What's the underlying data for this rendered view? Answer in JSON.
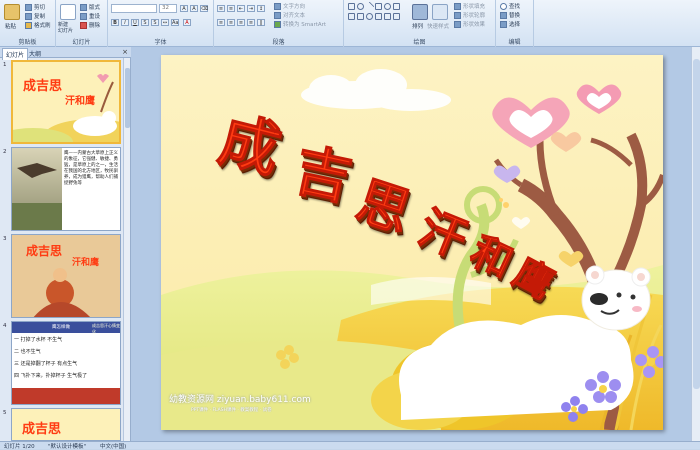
{
  "ribbon": {
    "clipboard": {
      "paste": "粘贴",
      "cut": "剪切",
      "copy": "复制",
      "format_painter": "格式刷",
      "group": "剪贴板"
    },
    "slides": {
      "new_slide": "新建\n幻灯片",
      "layout": "版式",
      "reset": "重设",
      "delete": "删除",
      "group": "幻灯片"
    },
    "font": {
      "font_size": "32",
      "bold": "B",
      "italic": "I",
      "underline": "U",
      "strike": "S",
      "group": "字体"
    },
    "paragraph": {
      "text_direction": "文字方向",
      "align_text": "对齐文本",
      "smartart": "转换为 SmartArt",
      "group": "段落"
    },
    "drawing": {
      "arrange": "排列",
      "quick_styles": "快速样式",
      "shape_fill": "形状填充",
      "shape_outline": "形状轮廓",
      "shape_effects": "形状效果",
      "group": "绘图"
    },
    "editing": {
      "find": "查找",
      "replace": "替换",
      "select": "选择",
      "group": "编辑"
    }
  },
  "panel": {
    "tab_slides": "幻灯片",
    "tab_outline": "大纲",
    "close": "×",
    "thumbs": [
      {
        "num": "1"
      },
      {
        "num": "2",
        "text": "鹰——内蒙古大草原上正义的象征，它强健、敏捷、勇猛，是草原上的之一，生活在我国的北方地区，牧民驯养，成为猎鹰，帮助人们捕捉野兔等"
      },
      {
        "num": "3"
      },
      {
        "num": "4",
        "rows": [
          "一 打掉了水杯 不生气",
          "二 也不生气",
          "三 还是掉翻了杯子 有点生气",
          "四 飞扑下来，扑掉杯子 生气极了"
        ],
        "header": [
          "",
          "鹰怎样做",
          "成吉思汗心情变化"
        ]
      },
      {
        "num": "5"
      }
    ]
  },
  "slide": {
    "title_chars": [
      "成",
      "吉",
      "思",
      "汗",
      "和",
      "鹰"
    ],
    "watermark": "幼教资源网 ziyuan.baby611.com",
    "watermark_sub": "PPT课件 · FLASH课件 · 教案教程 · 试卷"
  },
  "statusbar": {
    "slide_count": "幻灯片 1/20",
    "theme": "\"默认设计模板\"",
    "language": "中文(中国)"
  },
  "colors": {
    "title_red": "#ff3b12",
    "slide_bg": "#fdf6c9",
    "ribbon_blue": "#d3e2f3"
  }
}
